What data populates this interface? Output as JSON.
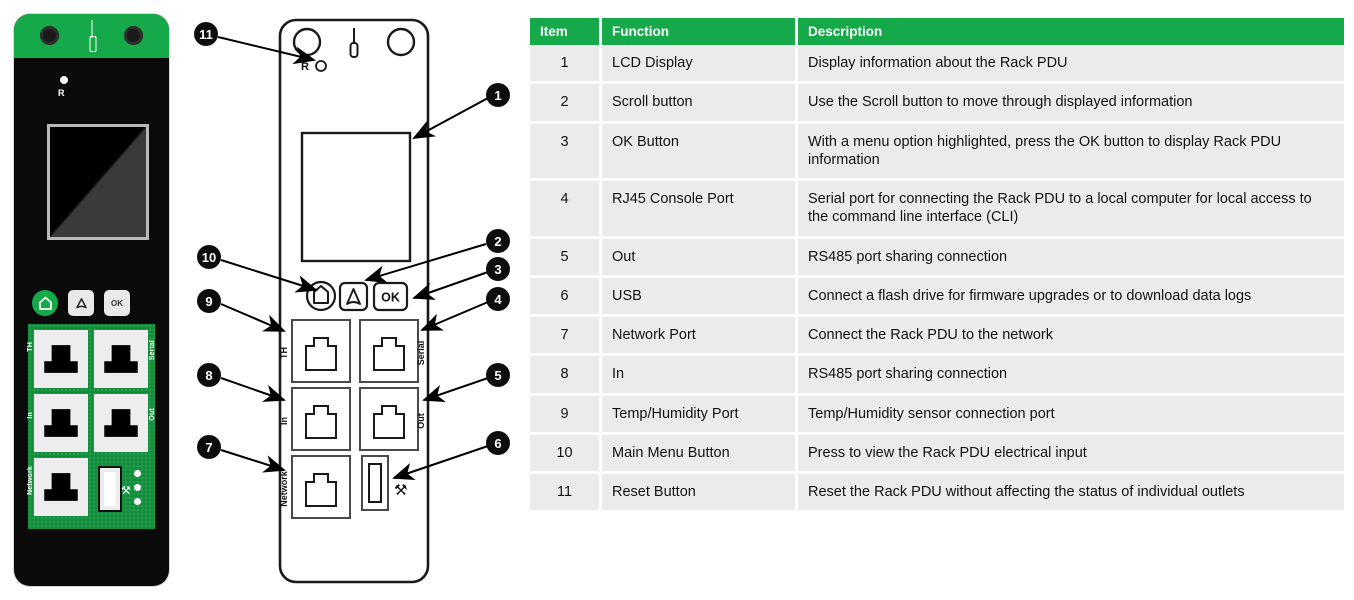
{
  "table": {
    "columns": [
      "Item",
      "Function",
      "Description"
    ],
    "rows": [
      {
        "item": "1",
        "function": "LCD Display",
        "description": "Display information about the Rack PDU"
      },
      {
        "item": "2",
        "function": "Scroll button",
        "description": "Use the Scroll button to move through displayed information"
      },
      {
        "item": "3",
        "function": "OK Button",
        "description": "With a menu option highlighted, press the OK button to display Rack PDU information"
      },
      {
        "item": "4",
        "function": "RJ45 Console Port",
        "description": "Serial port for connecting the Rack PDU to a local computer for local access to the command line interface (CLI)"
      },
      {
        "item": "5",
        "function": "Out",
        "description": "RS485 port sharing connection"
      },
      {
        "item": "6",
        "function": "USB",
        "description": "Connect a flash drive for firmware upgrades or to download data logs"
      },
      {
        "item": "7",
        "function": "Network Port",
        "description": "Connect the Rack PDU to the network"
      },
      {
        "item": "8",
        "function": "In",
        "description": "RS485 port sharing connection"
      },
      {
        "item": "9",
        "function": "Temp/Humidity Port",
        "description": "Temp/Humidity sensor connection port"
      },
      {
        "item": "10",
        "function": "Main Menu Button",
        "description": "Press to view the Rack PDU electrical input"
      },
      {
        "item": "11",
        "function": "Reset Button",
        "description": "Reset the Rack PDU without affecting the status of individual outlets"
      }
    ]
  },
  "photo": {
    "reset_label": "R",
    "buttons": {
      "home": "home-icon",
      "scroll": "scroll-icon",
      "ok": "OK"
    },
    "port_labels": {
      "th": "TH",
      "serial": "Serial",
      "in": "In",
      "out": "Out",
      "network": "Network"
    }
  },
  "diagram": {
    "reset_label": "R",
    "ok_label": "OK",
    "port_labels": {
      "th": "TH",
      "serial": "Serial",
      "in": "In",
      "out": "Out",
      "network": "Network"
    },
    "callouts": [
      "1",
      "2",
      "3",
      "4",
      "5",
      "6",
      "7",
      "8",
      "9",
      "10",
      "11"
    ]
  },
  "colors": {
    "brand_green": "#16a94a",
    "row_gray": "#ebebeb",
    "text": "#131313"
  }
}
